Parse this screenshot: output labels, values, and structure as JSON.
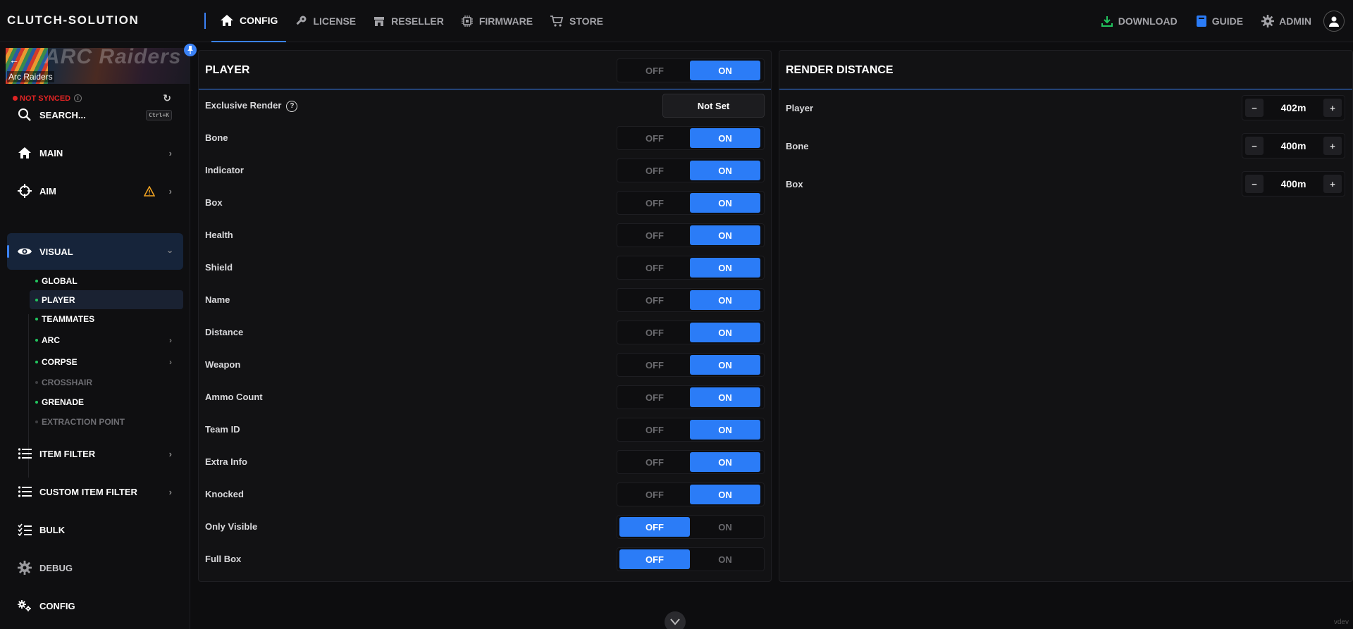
{
  "app": {
    "brand": "CLUTCH-SOLUTION",
    "watermark": "vdev"
  },
  "topnav": {
    "items": [
      {
        "label": "CONFIG",
        "icon": "home-icon",
        "active": true
      },
      {
        "label": "LICENSE",
        "icon": "key-icon"
      },
      {
        "label": "RESELLER",
        "icon": "store-icon"
      },
      {
        "label": "FIRMWARE",
        "icon": "chip-icon"
      },
      {
        "label": "STORE",
        "icon": "cart-icon"
      }
    ],
    "right": [
      {
        "label": "DOWNLOAD",
        "icon": "download-icon"
      },
      {
        "label": "GUIDE",
        "icon": "book-icon"
      },
      {
        "label": "ADMIN",
        "icon": "gear-icon"
      }
    ]
  },
  "sidebar": {
    "game": "Arc Raiders",
    "banner_text": "ARC Raiders",
    "sync_status": "NOT SYNCED",
    "search_label": "SEARCH...",
    "search_shortcut": "Ctrl+K",
    "items": [
      {
        "label": "MAIN",
        "icon": "home-icon"
      },
      {
        "label": "AIM",
        "icon": "crosshair-icon",
        "warning": true
      },
      {
        "label": "VISUAL",
        "icon": "eye-icon",
        "active": true,
        "expanded": true
      },
      {
        "label": "ITEM FILTER",
        "icon": "list-icon"
      },
      {
        "label": "CUSTOM ITEM FILTER",
        "icon": "list-icon"
      },
      {
        "label": "BULK",
        "icon": "checklist-icon"
      },
      {
        "label": "DEBUG",
        "icon": "gear-icon"
      },
      {
        "label": "CONFIG",
        "icon": "gears-icon"
      }
    ],
    "visual_sub": [
      {
        "label": "GLOBAL",
        "enabled": true
      },
      {
        "label": "PLAYER",
        "enabled": true,
        "active": true
      },
      {
        "label": "TEAMMATES",
        "enabled": true
      },
      {
        "label": "ARC",
        "enabled": true,
        "has_children": true
      },
      {
        "label": "CORPSE",
        "enabled": true,
        "has_children": true
      },
      {
        "label": "CROSSHAIR",
        "enabled": false
      },
      {
        "label": "GRENADE",
        "enabled": true
      },
      {
        "label": "EXTRACTION POINT",
        "enabled": false
      }
    ]
  },
  "toggle_labels": {
    "off": "OFF",
    "on": "ON"
  },
  "player_panel": {
    "title": "PLAYER",
    "master_on": true,
    "exclusive_render": {
      "label": "Exclusive Render",
      "value": "Not Set"
    },
    "rows": [
      {
        "label": "Bone",
        "on": true
      },
      {
        "label": "Indicator",
        "on": true
      },
      {
        "label": "Box",
        "on": true
      },
      {
        "label": "Health",
        "on": true
      },
      {
        "label": "Shield",
        "on": true
      },
      {
        "label": "Name",
        "on": true
      },
      {
        "label": "Distance",
        "on": true
      },
      {
        "label": "Weapon",
        "on": true
      },
      {
        "label": "Ammo Count",
        "on": true
      },
      {
        "label": "Team ID",
        "on": true
      },
      {
        "label": "Extra Info",
        "on": true
      },
      {
        "label": "Knocked",
        "on": true
      },
      {
        "label": "Only Visible",
        "on": false
      },
      {
        "label": "Full Box",
        "on": false
      }
    ]
  },
  "render_panel": {
    "title": "RENDER DISTANCE",
    "rows": [
      {
        "label": "Player",
        "value": "402m"
      },
      {
        "label": "Bone",
        "value": "400m"
      },
      {
        "label": "Box",
        "value": "400m"
      }
    ]
  },
  "colors": {
    "accent": "#2b7cf7",
    "synced_error": "#e02424",
    "enabled_dot": "#22c55e",
    "warning": "#f5a623"
  }
}
